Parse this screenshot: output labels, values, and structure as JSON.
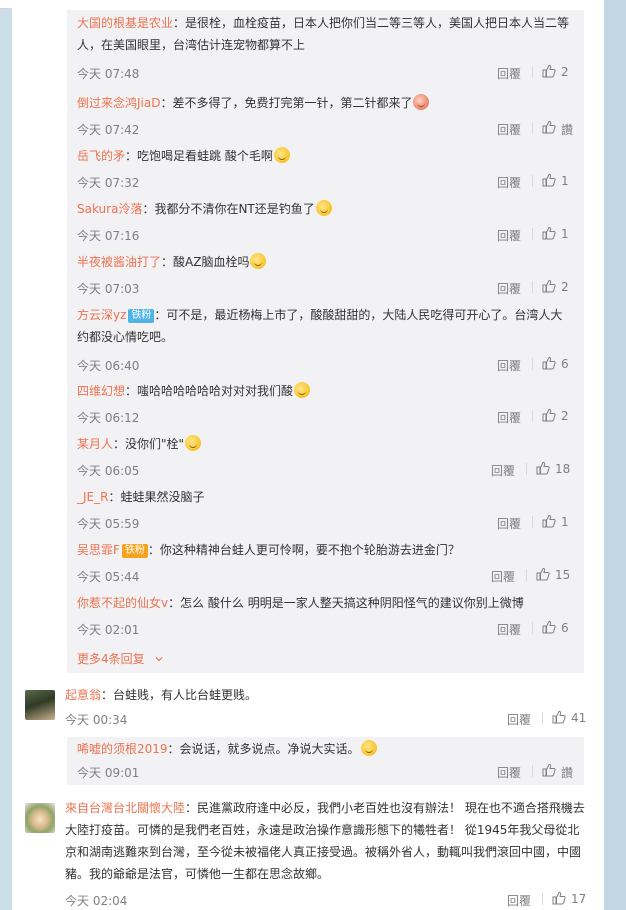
{
  "replies": [
    {
      "user": "大国的根基是农业",
      "text": "：是很栓，血栓疫苗，日本人把你们当二等三等人，美国人把日本人当二等",
      "text2": "人，在美国眼里，台湾估计连宠物都算不上",
      "time": "今天 07:48",
      "reply_label": "回覆",
      "likes": "2",
      "badge": "",
      "emoji": false
    },
    {
      "user": "倒过来念鸿JiaD",
      "text": "：差不多得了，免费打完第一针，第二针都来了",
      "text2": "",
      "time": "今天 07:42",
      "reply_label": "回覆",
      "likes": "讚",
      "badge": "",
      "emoji": true
    },
    {
      "user": "岳飞的矛",
      "text": "：吃饱喝足看蛙跳 酸个毛啊",
      "text2": "",
      "time": "今天 07:32",
      "reply_label": "回覆",
      "likes": "1",
      "badge": "",
      "emoji": true
    },
    {
      "user": "Sakura泠落",
      "text": "：我都分不清你在NT还是钓鱼了",
      "text2": "",
      "time": "今天 07:16",
      "reply_label": "回覆",
      "likes": "1",
      "badge": "",
      "emoji": true
    },
    {
      "user": "半夜被酱油打了",
      "text": "：酸AZ脑血栓吗",
      "text2": "",
      "time": "今天 07:03",
      "reply_label": "回覆",
      "likes": "2",
      "badge": "",
      "emoji": true
    },
    {
      "user": "方云深yz",
      "text": "：可不是，最近杨梅上市了，酸酸甜甜的，大陆人民吃得可开心了。台湾人大",
      "text2": "约都没心情吃吧。",
      "time": "今天 06:40",
      "reply_label": "回覆",
      "likes": "6",
      "badge": "铁粉",
      "emoji": false
    },
    {
      "user": "四维幻想",
      "text": "：嗤哈哈哈哈哈哈对对对我们酸",
      "text2": "",
      "time": "今天 06:12",
      "reply_label": "回覆",
      "likes": "2",
      "badge": "",
      "emoji": true
    },
    {
      "user": "某月人",
      "text": "：没你们\"栓\"",
      "text2": "",
      "time": "今天 06:05",
      "reply_label": "回覆",
      "likes": "18",
      "badge": "",
      "emoji": true
    },
    {
      "user": "_JE_R",
      "text": "：蛙蛙果然没脑子",
      "text2": "",
      "time": "今天 05:59",
      "reply_label": "回覆",
      "likes": "1",
      "badge": "",
      "emoji": false
    },
    {
      "user": "吴思霏F",
      "text": "：你这种精神台蛙人更可怜啊，要不抱个轮胎游去进金门？",
      "text2": "",
      "time": "今天 05:44",
      "reply_label": "回覆",
      "likes": "15",
      "badge": "铁粉",
      "emoji": false
    },
    {
      "user": "你惹不起的仙女v",
      "text": "：怎么 酸什么 明明是一家人整天搞这种阴阳怪气的建议你别上微博",
      "text2": "",
      "time": "今天 02:01",
      "reply_label": "回覆",
      "likes": "6",
      "badge": "",
      "emoji": false
    }
  ],
  "more_replies": "更多4条回复",
  "more_icon": "chevron-down-icon",
  "comments": [
    {
      "user": "起意翁",
      "text": "：台蛙贱，有人比台蛙更贱。",
      "time": "今天 00:34",
      "reply_label": "回覆",
      "likes": "41",
      "reply": {
        "user": "唏嘘的须根2019",
        "text": "：会说话，就多说点。净说大实话。",
        "time": "今天 09:01",
        "reply_label": "回覆",
        "likes": "讚"
      }
    },
    {
      "user": "來自台灣台北關懷大陸",
      "lines": [
        "：民進黨政府逢中必反，我們小老百姓也沒有辦法！ 現在也不適合搭飛機去",
        "大陸打疫苗。可憐的是我們老百姓，永遠是政治操作意識形態下的犧牲者！ 從1945年我父母從北",
        "京和湖南逃難來到台灣，至今從未被福佬人真正接受過。被稱外省人，動輒叫我們滾回中國，中國",
        "豬。我的爺爺是法官，可憐他一生都在思念故鄉。"
      ],
      "time": "今天 02:04",
      "reply_label": "回覆",
      "likes": "17"
    }
  ],
  "colors": {
    "username": "#eb7350",
    "background": "#ccdfe9",
    "reply_bg": "#f2f2f5",
    "meta": "#808080"
  },
  "icons": {
    "like": "thumbs-up-icon"
  }
}
